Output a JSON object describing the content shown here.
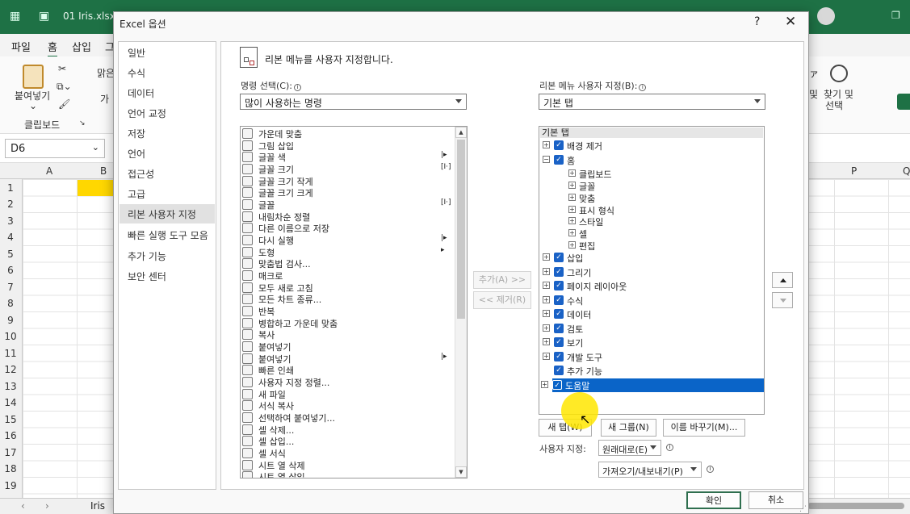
{
  "excel": {
    "filename": "01 Iris.xlsx",
    "menu": [
      "파일",
      "홈",
      "삽입",
      "그"
    ],
    "ribbon": {
      "paste": "붙여넣기",
      "clipboard": "클립보드",
      "font_partial": "맑은",
      "ga": "가",
      "find_select_1": "찾기 및",
      "find_select_2": "선택",
      "partial_1": "및",
      "partial_2": "ァ"
    },
    "namebox": "D6",
    "col_headers": [
      "A",
      "B",
      "P",
      "Q"
    ],
    "rows": [
      "1",
      "2",
      "3",
      "4",
      "5",
      "6",
      "7",
      "8",
      "9",
      "10",
      "11",
      "12",
      "13",
      "14",
      "15",
      "16",
      "17",
      "18",
      "19"
    ],
    "sheet_tab": "Iris"
  },
  "dialog": {
    "title": "Excel 옵션",
    "help": "?",
    "close": "✕",
    "nav": [
      "일반",
      "수식",
      "데이터",
      "언어 교정",
      "저장",
      "언어",
      "접근성",
      "고급",
      "리본 사용자 지정",
      "빠른 실행 도구 모음",
      "추가 기능",
      "보안 센터"
    ],
    "header": "리본 메뉴를 사용자 지정합니다.",
    "choose_label": "명령 선택(C):",
    "choose_value": "많이 사용하는 명령",
    "customize_label": "리본 메뉴 사용자 지정(B):",
    "customize_value": "기본 탭",
    "commands": [
      "가운데 맞춤",
      "그림 삽입",
      "글꼴 색",
      "글꼴 크기",
      "글꼴 크기 작게",
      "글꼴 크기 크게",
      "글꼴",
      "내림차순 정렬",
      "다른 이름으로 저장",
      "다시 실행",
      "도형",
      "맞춤법 검사...",
      "매크로",
      "모두 새로 고침",
      "모든 차트 종류...",
      "반복",
      "병합하고 가운데 맞춤",
      "복사",
      "붙여넣기",
      "붙여넣기",
      "빠른 인쇄",
      "사용자 지정 정렬...",
      "새 파일",
      "서식 복사",
      "선택하여 붙여넣기...",
      "셀 삭제...",
      "셀 삽입...",
      "셀 서식",
      "시트 열 삭제",
      "시트 열 삽입"
    ],
    "add_btn": "추가(A) >>",
    "remove_btn": "<< 제거(R)",
    "tree_header": "기본 탭",
    "tree": [
      {
        "label": "배경 제거",
        "level": 0,
        "exp": "⊞",
        "check": true
      },
      {
        "label": "홈",
        "level": 0,
        "exp": "⊟",
        "check": true
      },
      {
        "label": "클립보드",
        "level": 1,
        "exp": "⊞",
        "check": false
      },
      {
        "label": "글꼴",
        "level": 1,
        "exp": "⊞",
        "check": false
      },
      {
        "label": "맞춤",
        "level": 1,
        "exp": "⊞",
        "check": false
      },
      {
        "label": "표시 형식",
        "level": 1,
        "exp": "⊞",
        "check": false
      },
      {
        "label": "스타일",
        "level": 1,
        "exp": "⊞",
        "check": false
      },
      {
        "label": "셀",
        "level": 1,
        "exp": "⊞",
        "check": false
      },
      {
        "label": "편집",
        "level": 1,
        "exp": "⊞",
        "check": false
      },
      {
        "label": "삽입",
        "level": 0,
        "exp": "⊞",
        "check": true
      },
      {
        "label": "그리기",
        "level": 0,
        "exp": "⊞",
        "check": true
      },
      {
        "label": "페이지 레이아웃",
        "level": 0,
        "exp": "⊞",
        "check": true
      },
      {
        "label": "수식",
        "level": 0,
        "exp": "⊞",
        "check": true
      },
      {
        "label": "데이터",
        "level": 0,
        "exp": "⊞",
        "check": true
      },
      {
        "label": "검토",
        "level": 0,
        "exp": "⊞",
        "check": true
      },
      {
        "label": "보기",
        "level": 0,
        "exp": "⊞",
        "check": true
      },
      {
        "label": "개발 도구",
        "level": 0,
        "exp": "⊞",
        "check": true
      },
      {
        "label": "추가 기능",
        "level": 0,
        "exp": "",
        "check": true
      },
      {
        "label": "도움말",
        "level": 0,
        "exp": "⊞",
        "check": true,
        "selected": true
      }
    ],
    "new_tab": "새 탭(W)",
    "new_group": "새 그룹(N)",
    "rename": "이름 바꾸기(M)...",
    "customizations_label": "사용자 지정:",
    "reset": "원래대로(E)",
    "import_export": "가져오기/내보내기(P)",
    "ok": "확인",
    "cancel": "취소"
  }
}
